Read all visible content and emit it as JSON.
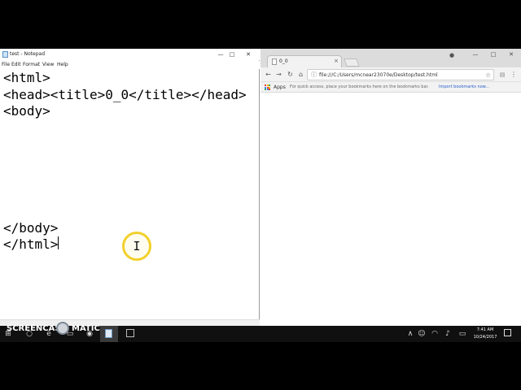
{
  "notepad": {
    "title": "test - Notepad",
    "menu": [
      "File",
      "Edit",
      "Format",
      "View",
      "Help"
    ],
    "lines": [
      "<html>",
      "<head><title>0_0</title></head>",
      "<body>",
      "",
      "",
      "",
      "",
      "",
      "",
      "</body>",
      "</html>"
    ]
  },
  "chrome": {
    "tab_title": "0_0",
    "url": "file:///C:/Users/mcnear23070e/Desktop/test.html",
    "bookmarks": {
      "apps_label": "Apps",
      "hint": "For quick access, place your bookmarks here on the bookmarks bar.",
      "import_link": "Import bookmarks now..."
    }
  },
  "watermark": {
    "recorded_with": "RECORDED WITH",
    "brand_left": "SCREENCAST",
    "brand_right": "MATIC"
  },
  "taskbar": {
    "time": "7:41 AM",
    "date": "10/24/2017"
  },
  "icons": {
    "colors": {
      "apps_grid": [
        "#ea4335",
        "#fbbc05",
        "#34a853",
        "#4285f4",
        "#ea4335",
        "#fbbc05",
        "#34a853",
        "#4285f4",
        "#ea4335"
      ],
      "link": "#2a62c9",
      "cursor_ring": "#f2d02b"
    }
  }
}
